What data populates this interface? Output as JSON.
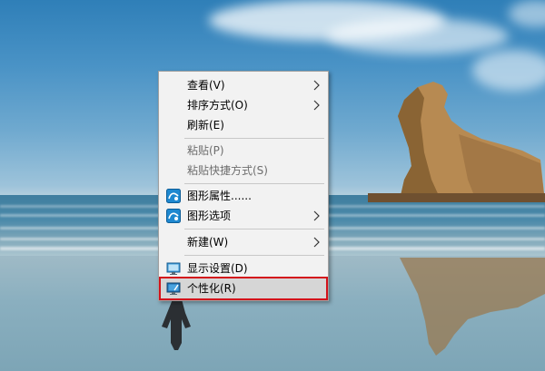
{
  "context_menu": {
    "items": [
      {
        "label": "查看(V)",
        "has_submenu": true,
        "disabled": false
      },
      {
        "label": "排序方式(O)",
        "has_submenu": true,
        "disabled": false
      },
      {
        "label": "刷新(E)",
        "has_submenu": false,
        "disabled": false
      },
      {
        "label": "粘贴(P)",
        "has_submenu": false,
        "disabled": true
      },
      {
        "label": "粘贴快捷方式(S)",
        "has_submenu": false,
        "disabled": true
      },
      {
        "label": "图形属性......",
        "has_submenu": false,
        "disabled": false,
        "icon": "intel-graphics-icon"
      },
      {
        "label": "图形选项",
        "has_submenu": true,
        "disabled": false,
        "icon": "intel-graphics-icon"
      },
      {
        "label": "新建(W)",
        "has_submenu": true,
        "disabled": false
      },
      {
        "label": "显示设置(D)",
        "has_submenu": false,
        "disabled": false,
        "icon": "display-settings-icon"
      },
      {
        "label": "个性化(R)",
        "has_submenu": false,
        "disabled": false,
        "icon": "personalize-icon",
        "highlighted": true
      }
    ]
  },
  "colors": {
    "menu_background": "#f2f2f2",
    "highlight_border": "#d3121b",
    "disabled_text": "#6d6d6d"
  }
}
